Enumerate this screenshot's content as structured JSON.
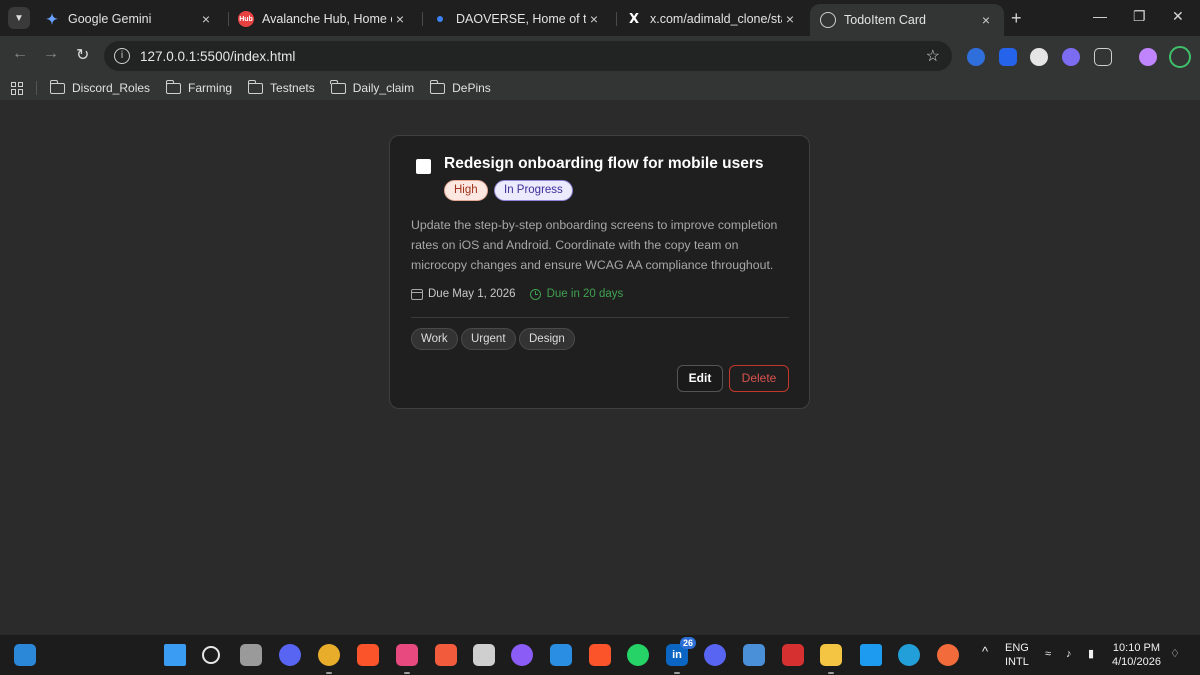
{
  "browser": {
    "tabs": [
      {
        "title": "Google Gemini",
        "favicon": "gemini-icon",
        "active": false
      },
      {
        "title": "Avalanche Hub, Home of the",
        "favicon": "avalanche-hub-icon",
        "favicon_text": "Hub",
        "active": false
      },
      {
        "title": "DAOVERSE, Home of the DA",
        "favicon": "daoverse-icon",
        "active": false
      },
      {
        "title": "x.com/adimald_clone/status",
        "favicon": "x-icon",
        "favicon_text": "X",
        "active": false
      },
      {
        "title": "TodoItem Card",
        "favicon": "globe-icon",
        "active": true
      }
    ],
    "url": "127.0.0.1:5500/index.html",
    "bookmarks": [
      "Discord_Roles",
      "Farming",
      "Testnets",
      "Daily_claim",
      "DePins"
    ]
  },
  "card": {
    "title": "Redesign onboarding flow for mobile users",
    "completed": false,
    "priority": "High",
    "status": "In Progress",
    "description": "Update the step-by-step onboarding screens to improve completion rates on iOS and Android. Coordinate with the copy team on microcopy changes and ensure WCAG AA compliance throughout.",
    "due_date": "Due May 1, 2026",
    "time_remaining": "Due in 20 days",
    "tags": [
      "Work",
      "Urgent",
      "Design"
    ],
    "edit_label": "Edit",
    "delete_label": "Delete"
  },
  "taskbar": {
    "linkedin_badge": "26",
    "lang": "ENG",
    "layout": "INTL",
    "time": "10:10 PM",
    "date": "4/10/2026"
  },
  "colors": {
    "page_bg": "#2b2b2b",
    "card_bg": "#1f1f1f",
    "high_priority": "#fde8e1",
    "in_progress": "#eceafd",
    "due_green": "#3fa150",
    "delete_red": "#d9534f"
  }
}
